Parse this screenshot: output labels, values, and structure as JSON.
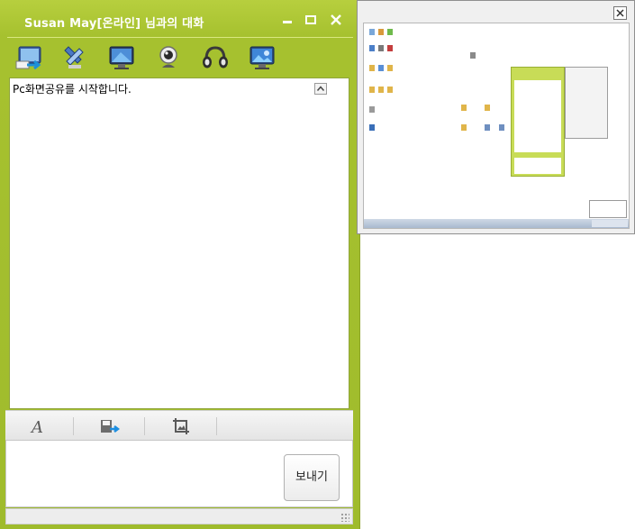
{
  "chat": {
    "title": "Susan May[온라인] 님과의 대화",
    "window_buttons": {
      "minimize": "–",
      "maximize": "▫",
      "close": "✕"
    },
    "toolbar": [
      "send-file",
      "remote-control",
      "screen-share",
      "webcam",
      "voice-chat",
      "desktop"
    ],
    "messages": [
      "Pc화면공유를 시작합니다."
    ],
    "collapse_symbol": "⌃",
    "format_toolbar": [
      "font",
      "save-chat",
      "capture"
    ],
    "input_value": "",
    "send_label": "보내기"
  },
  "share_window": {
    "close_symbol": "✕"
  },
  "colors": {
    "window_green": "#a6c12f",
    "title_text": "#ffffff"
  }
}
